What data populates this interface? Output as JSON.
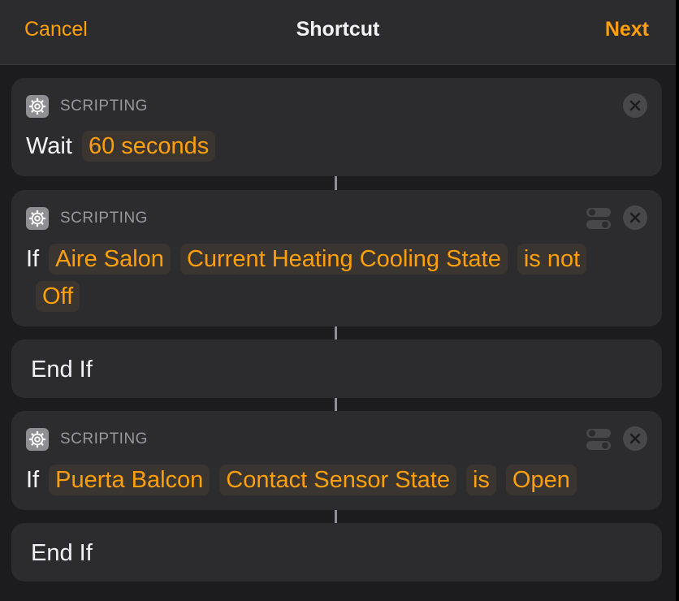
{
  "navbar": {
    "cancel_label": "Cancel",
    "title": "Shortcut",
    "next_label": "Next"
  },
  "colors": {
    "accent": "#ff9f0a",
    "background": "#1c1c1e",
    "card": "#2c2c2e",
    "token_bg": "#3a3530",
    "secondary_text": "#98989d"
  },
  "actions": [
    {
      "category": "SCRIPTING",
      "icon": "gear-icon",
      "keyword": "Wait",
      "tokens": [
        "60 seconds"
      ]
    },
    {
      "category": "SCRIPTING",
      "icon": "gear-icon",
      "keyword": "If",
      "tokens": [
        "Aire Salon",
        "Current Heating Cooling State",
        "is not",
        "Off"
      ]
    },
    {
      "label": "End If"
    },
    {
      "category": "SCRIPTING",
      "icon": "gear-icon",
      "keyword": "If",
      "tokens": [
        "Puerta Balcon",
        "Contact Sensor State",
        "is",
        "Open"
      ]
    },
    {
      "label": "End If"
    }
  ]
}
